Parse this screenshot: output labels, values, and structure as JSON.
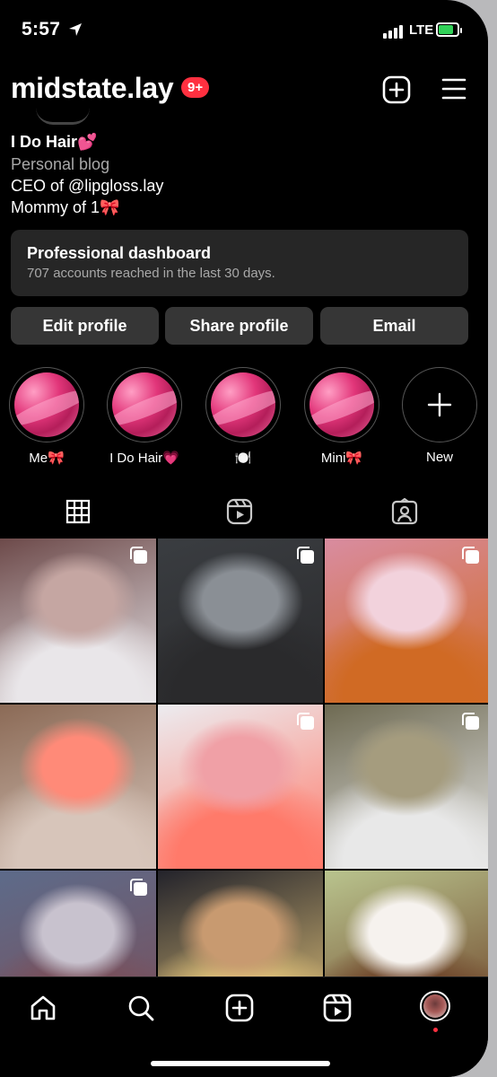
{
  "status": {
    "time": "5:57",
    "network": "LTE"
  },
  "header": {
    "username": "midstate.lay",
    "notification_badge": "9+"
  },
  "bio": {
    "name": "I Do Hair💕",
    "category": "Personal blog",
    "line1": "CEO of @lipgloss.lay",
    "line2": "Mommy of 1🎀"
  },
  "dashboard": {
    "title": "Professional dashboard",
    "subtitle": "707 accounts reached in the last 30 days."
  },
  "buttons": {
    "edit": "Edit profile",
    "share": "Share profile",
    "email": "Email"
  },
  "highlights": [
    {
      "label": "Me🎀"
    },
    {
      "label": "I Do Hair💗"
    },
    {
      "label": "🍽️"
    },
    {
      "label": "Mini🎀"
    },
    {
      "label": "New"
    }
  ],
  "tabs": [
    "grid-icon",
    "reels-icon",
    "tagged-icon"
  ],
  "posts": [
    {
      "colors": [
        "#6d4a4a",
        "#c5a6a2",
        "#e9e6e9"
      ],
      "multi": true
    },
    {
      "colors": [
        "#3a3d41",
        "#8a8f95",
        "#2a2a2c"
      ],
      "multi": true
    },
    {
      "colors": [
        "#d98ca0",
        "#f2d2dc",
        "#d06a24"
      ],
      "multi": true
    },
    {
      "colors": [
        "#8b6a56",
        "#ff8a78",
        "#d7c5ba"
      ],
      "multi": false
    },
    {
      "colors": [
        "#ececf0",
        "#f0a0a6",
        "#ff7a6a"
      ],
      "multi": true
    },
    {
      "colors": [
        "#6e6a52",
        "#a59c7e",
        "#e8e8e8"
      ],
      "multi": true
    },
    {
      "colors": [
        "#5d6b8a",
        "#c8c2ce",
        "#7a4f5a"
      ],
      "multi": true
    },
    {
      "colors": [
        "#23232b",
        "#c89a70",
        "#e1c27a"
      ],
      "multi": false
    },
    {
      "colors": [
        "#b9c48e",
        "#f6f2ee",
        "#6d4228"
      ],
      "multi": false
    }
  ],
  "nav": [
    "home-icon",
    "search-icon",
    "create-icon",
    "reels-icon",
    "profile-avatar"
  ]
}
